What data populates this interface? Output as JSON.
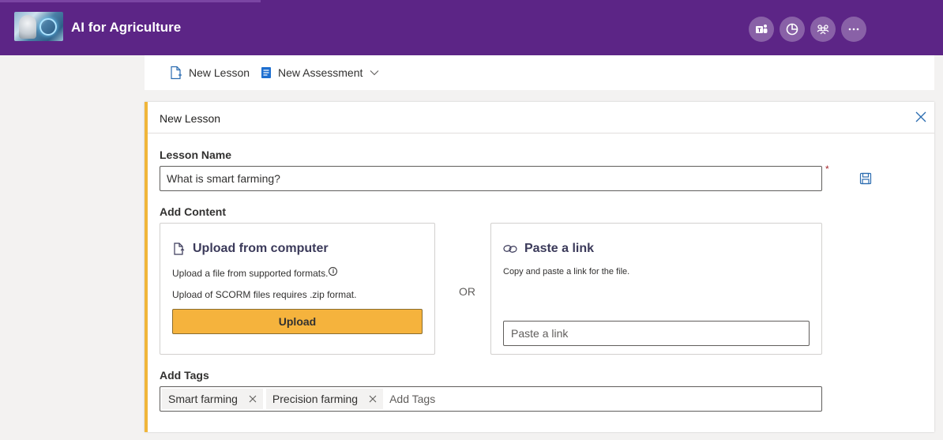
{
  "header": {
    "app_title": "AI for Agriculture",
    "background_color": "#5c2586",
    "logo_icon": "robot-ai-logo",
    "actions": [
      {
        "name": "teams-icon"
      },
      {
        "name": "analytics-icon"
      },
      {
        "name": "people-icon"
      },
      {
        "name": "more-icon"
      }
    ]
  },
  "commandbar": {
    "new_lesson": "New Lesson",
    "new_assessment": "New Assessment"
  },
  "panel": {
    "title": "New Lesson",
    "accent_color": "#f0b63a",
    "lesson_name_label": "Lesson Name",
    "lesson_name_value": "What is smart farming?",
    "required_mark": "*",
    "add_content_label": "Add Content",
    "upload_card": {
      "title": "Upload from computer",
      "line1": "Upload a file from supported formats.",
      "info_symbol": "i",
      "line2": "Upload of SCORM files requires .zip format.",
      "button": "Upload",
      "button_color": "#f5b33d"
    },
    "or_text": "OR",
    "link_card": {
      "title": "Paste a link",
      "desc": "Copy and paste a link for the file.",
      "placeholder": "Paste a link"
    },
    "add_tags_label": "Add Tags",
    "tags": [
      "Smart farming",
      "Precision farming"
    ],
    "tags_placeholder": "Add Tags"
  }
}
